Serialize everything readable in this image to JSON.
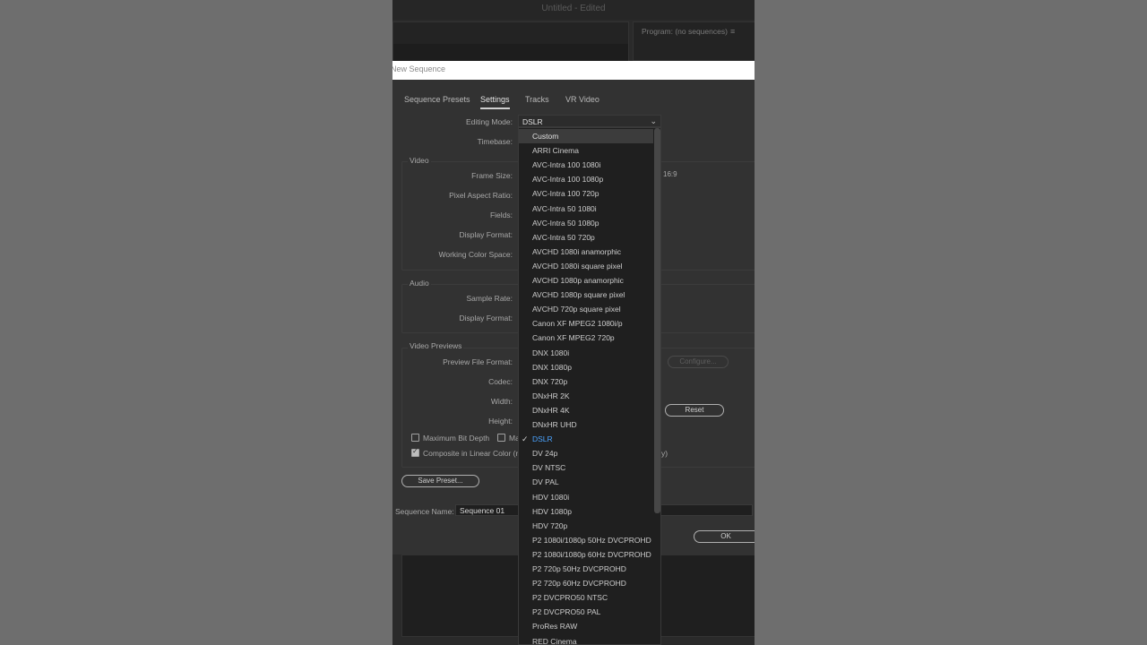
{
  "app": {
    "title": "Untitled - Edited"
  },
  "program_panel": {
    "label": "Program: (no sequences)",
    "menu_icon": "hamburger-icon"
  },
  "dialog": {
    "title": "New Sequence",
    "tabs": [
      "Sequence Presets",
      "Settings",
      "Tracks",
      "VR Video"
    ],
    "active_tab": "Settings",
    "editing_mode": {
      "label": "Editing Mode:",
      "value": "DSLR"
    },
    "timebase": {
      "label": "Timebase:"
    },
    "video": {
      "heading": "Video",
      "frame_size": "Frame Size:",
      "frame_ratio": "16:9",
      "pixel_aspect_ratio": "Pixel Aspect Ratio:",
      "fields": "Fields:",
      "display_format": "Display Format:",
      "working_color_space": "Working Color Space:"
    },
    "audio": {
      "heading": "Audio",
      "sample_rate": "Sample Rate:",
      "display_format": "Display Format:"
    },
    "video_previews": {
      "heading": "Video Previews",
      "preview_file_format": "Preview File Format:",
      "configure_button": "Configure...",
      "codec": "Codec:",
      "width": "Width:",
      "height": "Height:",
      "reset_button": "Reset"
    },
    "checkboxes": {
      "max_bit_depth": "Maximum Bit Depth",
      "max_render_partial": "Ma",
      "composite_linear": "Composite in Linear Color (re",
      "composite_tail": "y)"
    },
    "save_preset_button": "Save Preset...",
    "sequence_name": {
      "label": "Sequence Name:",
      "value": "Sequence 01"
    },
    "ok_button": "OK"
  },
  "dropdown": {
    "items": [
      "Custom",
      "ARRI Cinema",
      "AVC-Intra 100 1080i",
      "AVC-Intra 100 1080p",
      "AVC-Intra 100 720p",
      "AVC-Intra 50 1080i",
      "AVC-Intra 50 1080p",
      "AVC-Intra 50 720p",
      "AVCHD 1080i anamorphic",
      "AVCHD 1080i square pixel",
      "AVCHD 1080p anamorphic",
      "AVCHD 1080p square pixel",
      "AVCHD 720p square pixel",
      "Canon XF MPEG2 1080i/p",
      "Canon XF MPEG2 720p",
      "DNX 1080i",
      "DNX 1080p",
      "DNX 720p",
      "DNxHR 2K",
      "DNxHR 4K",
      "DNxHR UHD",
      "DSLR",
      "DV 24p",
      "DV NTSC",
      "DV PAL",
      "HDV 1080i",
      "HDV 1080p",
      "HDV 720p",
      "P2 1080i/1080p 50Hz DVCPROHD",
      "P2 1080i/1080p 60Hz DVCPROHD",
      "P2 720p 50Hz DVCPROHD",
      "P2 720p 60Hz DVCPROHD",
      "P2 DVCPRO50 NTSC",
      "P2 DVCPRO50 PAL",
      "ProRes RAW",
      "RED Cinema"
    ],
    "hovered": "Custom",
    "selected": "DSLR",
    "check_mark": "✓",
    "selected_color": "#4aa3ff"
  }
}
